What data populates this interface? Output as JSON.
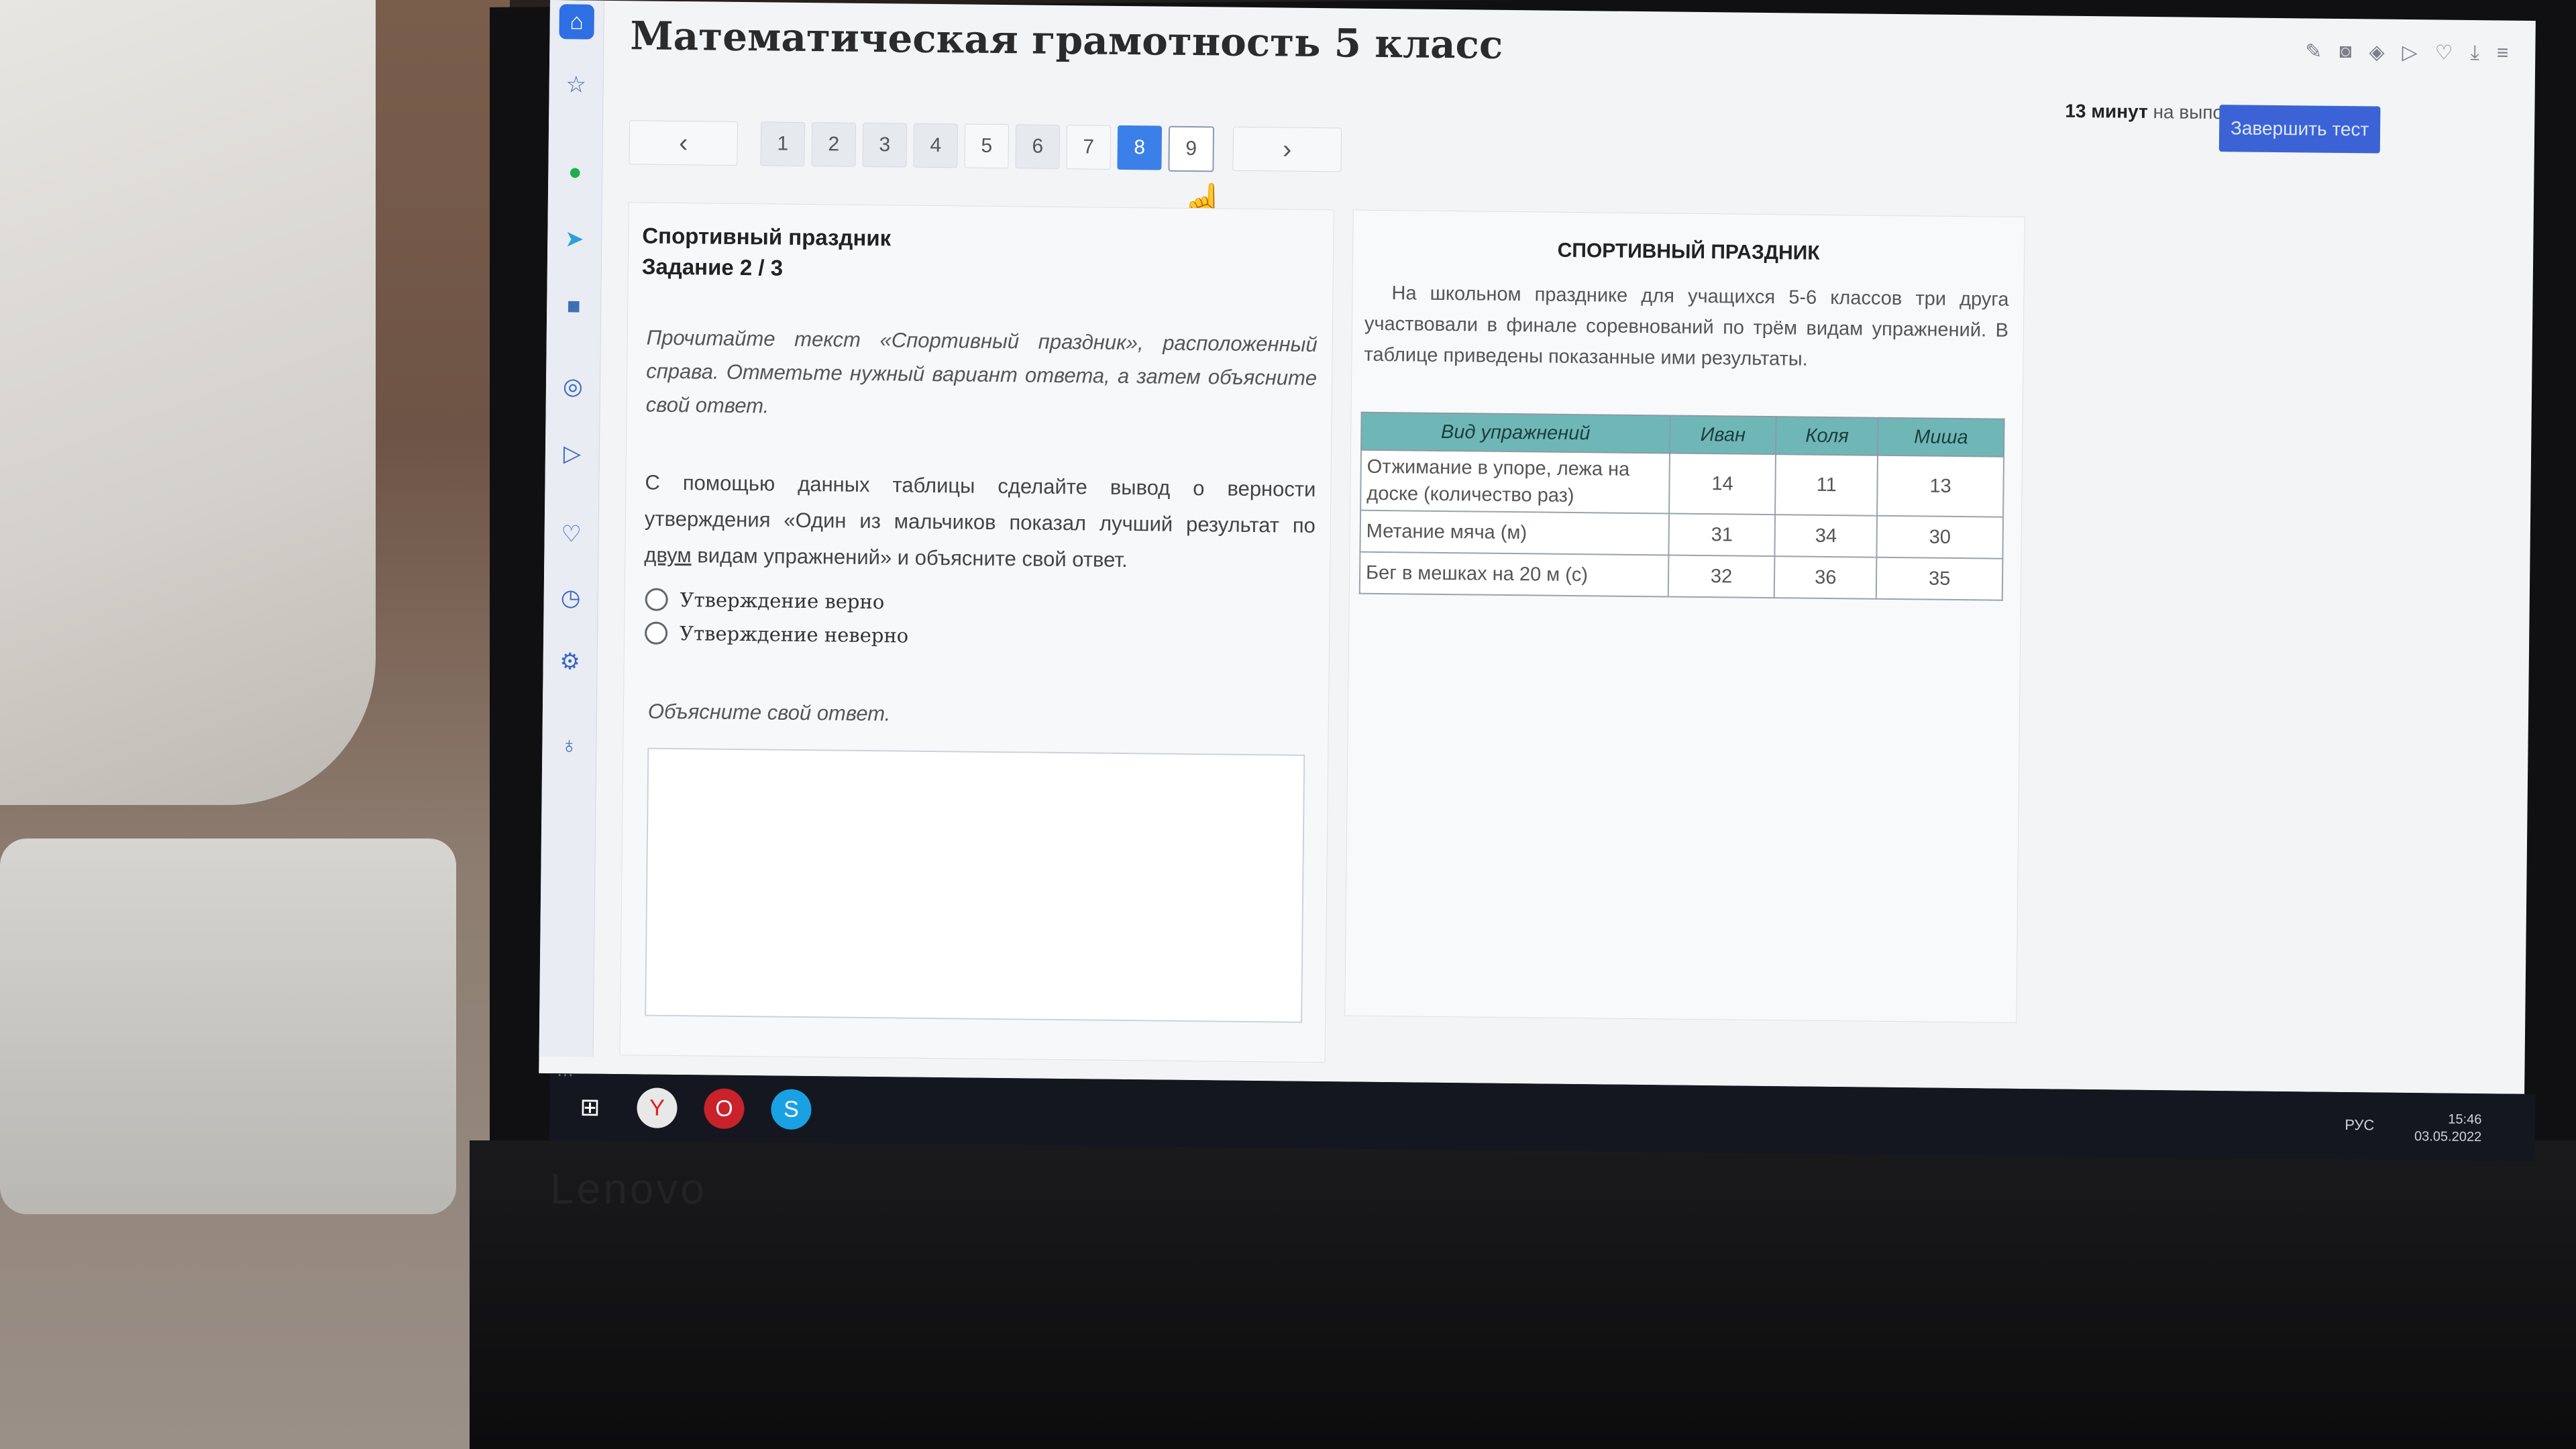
{
  "header": {
    "title": "Математическая грамотность 5 класс",
    "timer_bold": "13 минут",
    "timer_text": " на выполнение работы",
    "finish_label": "Завершить тест"
  },
  "pager": {
    "prev": "‹",
    "next": "›",
    "pages": [
      "1",
      "2",
      "3",
      "4",
      "5",
      "6",
      "7",
      "8",
      "9"
    ],
    "active": "8"
  },
  "task": {
    "name": "Спортивный праздник",
    "number": "Задание 2 / 3",
    "instruction": "Прочитайте текст «Спортивный праздник», расположенный справа. Отметьте нужный вариант ответа, а затем объясните свой ответ.",
    "question_pre": "С помощью данных таблицы сделайте вывод о верности утверждения «Один из мальчиков показал лучший результат по ",
    "question_underlined": "двум",
    "question_post": " видам упражнений» и объясните свой ответ.",
    "options": [
      "Утверждение верно",
      "Утверждение неверно"
    ],
    "explain_label": "Объясните свой ответ."
  },
  "text_panel": {
    "title": "СПОРТИВНЫЙ ПРАЗДНИК",
    "body": "На школьном празднике для учащихся 5-6 классов три друга участвовали в финале соревнований по трём видам упражнений. В таблице приведены показанные ими результаты.",
    "table": {
      "headers": [
        "Вид упражнений",
        "Иван",
        "Коля",
        "Миша"
      ],
      "rows": [
        [
          "Отжимание в упоре, лежа на доске (количество раз)",
          "14",
          "11",
          "13"
        ],
        [
          "Метание мяча (м)",
          "31",
          "34",
          "30"
        ],
        [
          "Бег в мешках на 20 м (с)",
          "32",
          "36",
          "35"
        ]
      ]
    }
  },
  "taskbar": {
    "lang": "РУС",
    "time": "15:46",
    "date": "03.05.2022",
    "more": "..."
  },
  "device": {
    "brand": "Lenovo"
  },
  "colors": {
    "accent": "#3b80e8",
    "finish": "#3b63d6",
    "table_header": "#6fb7b7"
  }
}
